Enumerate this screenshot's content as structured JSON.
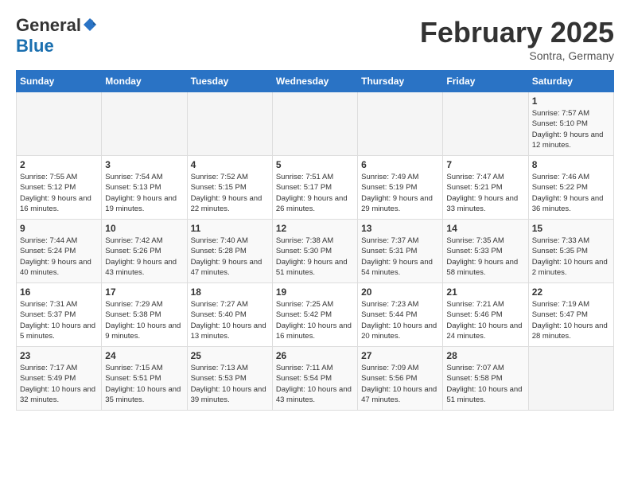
{
  "header": {
    "logo_line1": "General",
    "logo_line2": "Blue",
    "month_title": "February 2025",
    "subtitle": "Sontra, Germany"
  },
  "weekdays": [
    "Sunday",
    "Monday",
    "Tuesday",
    "Wednesday",
    "Thursday",
    "Friday",
    "Saturday"
  ],
  "weeks": [
    [
      {
        "day": "",
        "info": ""
      },
      {
        "day": "",
        "info": ""
      },
      {
        "day": "",
        "info": ""
      },
      {
        "day": "",
        "info": ""
      },
      {
        "day": "",
        "info": ""
      },
      {
        "day": "",
        "info": ""
      },
      {
        "day": "1",
        "info": "Sunrise: 7:57 AM\nSunset: 5:10 PM\nDaylight: 9 hours and 12 minutes."
      }
    ],
    [
      {
        "day": "2",
        "info": "Sunrise: 7:55 AM\nSunset: 5:12 PM\nDaylight: 9 hours and 16 minutes."
      },
      {
        "day": "3",
        "info": "Sunrise: 7:54 AM\nSunset: 5:13 PM\nDaylight: 9 hours and 19 minutes."
      },
      {
        "day": "4",
        "info": "Sunrise: 7:52 AM\nSunset: 5:15 PM\nDaylight: 9 hours and 22 minutes."
      },
      {
        "day": "5",
        "info": "Sunrise: 7:51 AM\nSunset: 5:17 PM\nDaylight: 9 hours and 26 minutes."
      },
      {
        "day": "6",
        "info": "Sunrise: 7:49 AM\nSunset: 5:19 PM\nDaylight: 9 hours and 29 minutes."
      },
      {
        "day": "7",
        "info": "Sunrise: 7:47 AM\nSunset: 5:21 PM\nDaylight: 9 hours and 33 minutes."
      },
      {
        "day": "8",
        "info": "Sunrise: 7:46 AM\nSunset: 5:22 PM\nDaylight: 9 hours and 36 minutes."
      }
    ],
    [
      {
        "day": "9",
        "info": "Sunrise: 7:44 AM\nSunset: 5:24 PM\nDaylight: 9 hours and 40 minutes."
      },
      {
        "day": "10",
        "info": "Sunrise: 7:42 AM\nSunset: 5:26 PM\nDaylight: 9 hours and 43 minutes."
      },
      {
        "day": "11",
        "info": "Sunrise: 7:40 AM\nSunset: 5:28 PM\nDaylight: 9 hours and 47 minutes."
      },
      {
        "day": "12",
        "info": "Sunrise: 7:38 AM\nSunset: 5:30 PM\nDaylight: 9 hours and 51 minutes."
      },
      {
        "day": "13",
        "info": "Sunrise: 7:37 AM\nSunset: 5:31 PM\nDaylight: 9 hours and 54 minutes."
      },
      {
        "day": "14",
        "info": "Sunrise: 7:35 AM\nSunset: 5:33 PM\nDaylight: 9 hours and 58 minutes."
      },
      {
        "day": "15",
        "info": "Sunrise: 7:33 AM\nSunset: 5:35 PM\nDaylight: 10 hours and 2 minutes."
      }
    ],
    [
      {
        "day": "16",
        "info": "Sunrise: 7:31 AM\nSunset: 5:37 PM\nDaylight: 10 hours and 5 minutes."
      },
      {
        "day": "17",
        "info": "Sunrise: 7:29 AM\nSunset: 5:38 PM\nDaylight: 10 hours and 9 minutes."
      },
      {
        "day": "18",
        "info": "Sunrise: 7:27 AM\nSunset: 5:40 PM\nDaylight: 10 hours and 13 minutes."
      },
      {
        "day": "19",
        "info": "Sunrise: 7:25 AM\nSunset: 5:42 PM\nDaylight: 10 hours and 16 minutes."
      },
      {
        "day": "20",
        "info": "Sunrise: 7:23 AM\nSunset: 5:44 PM\nDaylight: 10 hours and 20 minutes."
      },
      {
        "day": "21",
        "info": "Sunrise: 7:21 AM\nSunset: 5:46 PM\nDaylight: 10 hours and 24 minutes."
      },
      {
        "day": "22",
        "info": "Sunrise: 7:19 AM\nSunset: 5:47 PM\nDaylight: 10 hours and 28 minutes."
      }
    ],
    [
      {
        "day": "23",
        "info": "Sunrise: 7:17 AM\nSunset: 5:49 PM\nDaylight: 10 hours and 32 minutes."
      },
      {
        "day": "24",
        "info": "Sunrise: 7:15 AM\nSunset: 5:51 PM\nDaylight: 10 hours and 35 minutes."
      },
      {
        "day": "25",
        "info": "Sunrise: 7:13 AM\nSunset: 5:53 PM\nDaylight: 10 hours and 39 minutes."
      },
      {
        "day": "26",
        "info": "Sunrise: 7:11 AM\nSunset: 5:54 PM\nDaylight: 10 hours and 43 minutes."
      },
      {
        "day": "27",
        "info": "Sunrise: 7:09 AM\nSunset: 5:56 PM\nDaylight: 10 hours and 47 minutes."
      },
      {
        "day": "28",
        "info": "Sunrise: 7:07 AM\nSunset: 5:58 PM\nDaylight: 10 hours and 51 minutes."
      },
      {
        "day": "",
        "info": ""
      }
    ]
  ]
}
